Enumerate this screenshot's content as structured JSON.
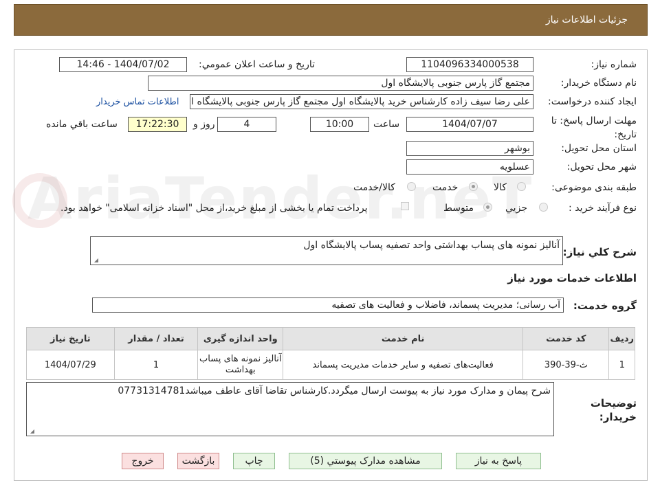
{
  "header": {
    "title": "جزئيات اطلاعات نياز"
  },
  "fields": {
    "need_number_label": "شماره نياز:",
    "need_number": "1104096334000538",
    "announce_label": "تاريخ و ساعت اعلان عمومي:",
    "announce_value": "1404/07/02 - 14:46",
    "buyer_org_label": "نام دستگاه خريدار:",
    "buyer_org": "مجتمع گاز پارس جنوبی  پالایشگاه اول",
    "requester_label": "ايجاد کننده درخواست:",
    "requester": "علی رضا سیف زاده کارشناس خرید پالایشگاه اول مجتمع گاز پارس جنوبی  پالایشگاه اول",
    "contact_link": "اطلاعات تماس خريدار",
    "deadline_label": "مهلت ارسال پاسخ: تا تاريخ:",
    "deadline_date": "1404/07/07",
    "hour_label": "ساعت",
    "deadline_time": "10:00",
    "days_value": "4",
    "days_label": "روز و",
    "remaining_time": "17:22:30",
    "remaining_label": "ساعت باقي مانده",
    "province_label": "استان محل تحويل:",
    "province": "بوشهر",
    "city_label": "شهر محل تحويل:",
    "city": "عسلویه",
    "category_label": "طبقه بندی موضوعی:",
    "category_options": [
      "کالا",
      "خدمت",
      "کالا/خدمت"
    ],
    "process_label": "نوع فرآيند خريد :",
    "process_options": [
      "جزيي",
      "متوسط"
    ],
    "payment_note": "پرداخت تمام یا بخشی از مبلغ خرید،از محل \"اسناد خزانه اسلامی\" خواهد بود.",
    "summary_label": "شرح کلي نياز:",
    "summary": "آنالیز نمونه های پساب بهداشتی واحد تصفیه پساب پالایشگاه اول",
    "services_heading": "اطلاعات خدمات مورد نياز",
    "service_group_label": "گروه خدمت:",
    "service_group": "آب رسانی؛ مدیریت پسماند، فاضلاب و فعالیت های تصفیه",
    "buyer_notes_label_1": "توضيحات",
    "buyer_notes_label_2": "خريدار:",
    "buyer_notes": "شرح پیمان و مدارک مورد نیاز به پیوست ارسال میگردد.کارشناس تقاضا آقای عاطف میباشد07731314781"
  },
  "table": {
    "headers": [
      "رديف",
      "کد خدمت",
      "نام خدمت",
      "واحد اندازه گيری",
      "تعداد / مقدار",
      "تاريخ نياز"
    ],
    "rows": [
      [
        "1",
        "ث-39-390",
        "فعالیت‌های تصفیه و سایر خدمات مدیریت پسماند",
        "آنالیز نمونه های پساب بهداشت",
        "1",
        "1404/07/29"
      ]
    ]
  },
  "buttons": {
    "respond": "پاسخ به نياز",
    "attachments": "مشاهده مدارک پيوستي (5)",
    "print": "چاپ",
    "back": "بازگشت",
    "exit": "خروج"
  },
  "watermark": "AriaTender.neT"
}
